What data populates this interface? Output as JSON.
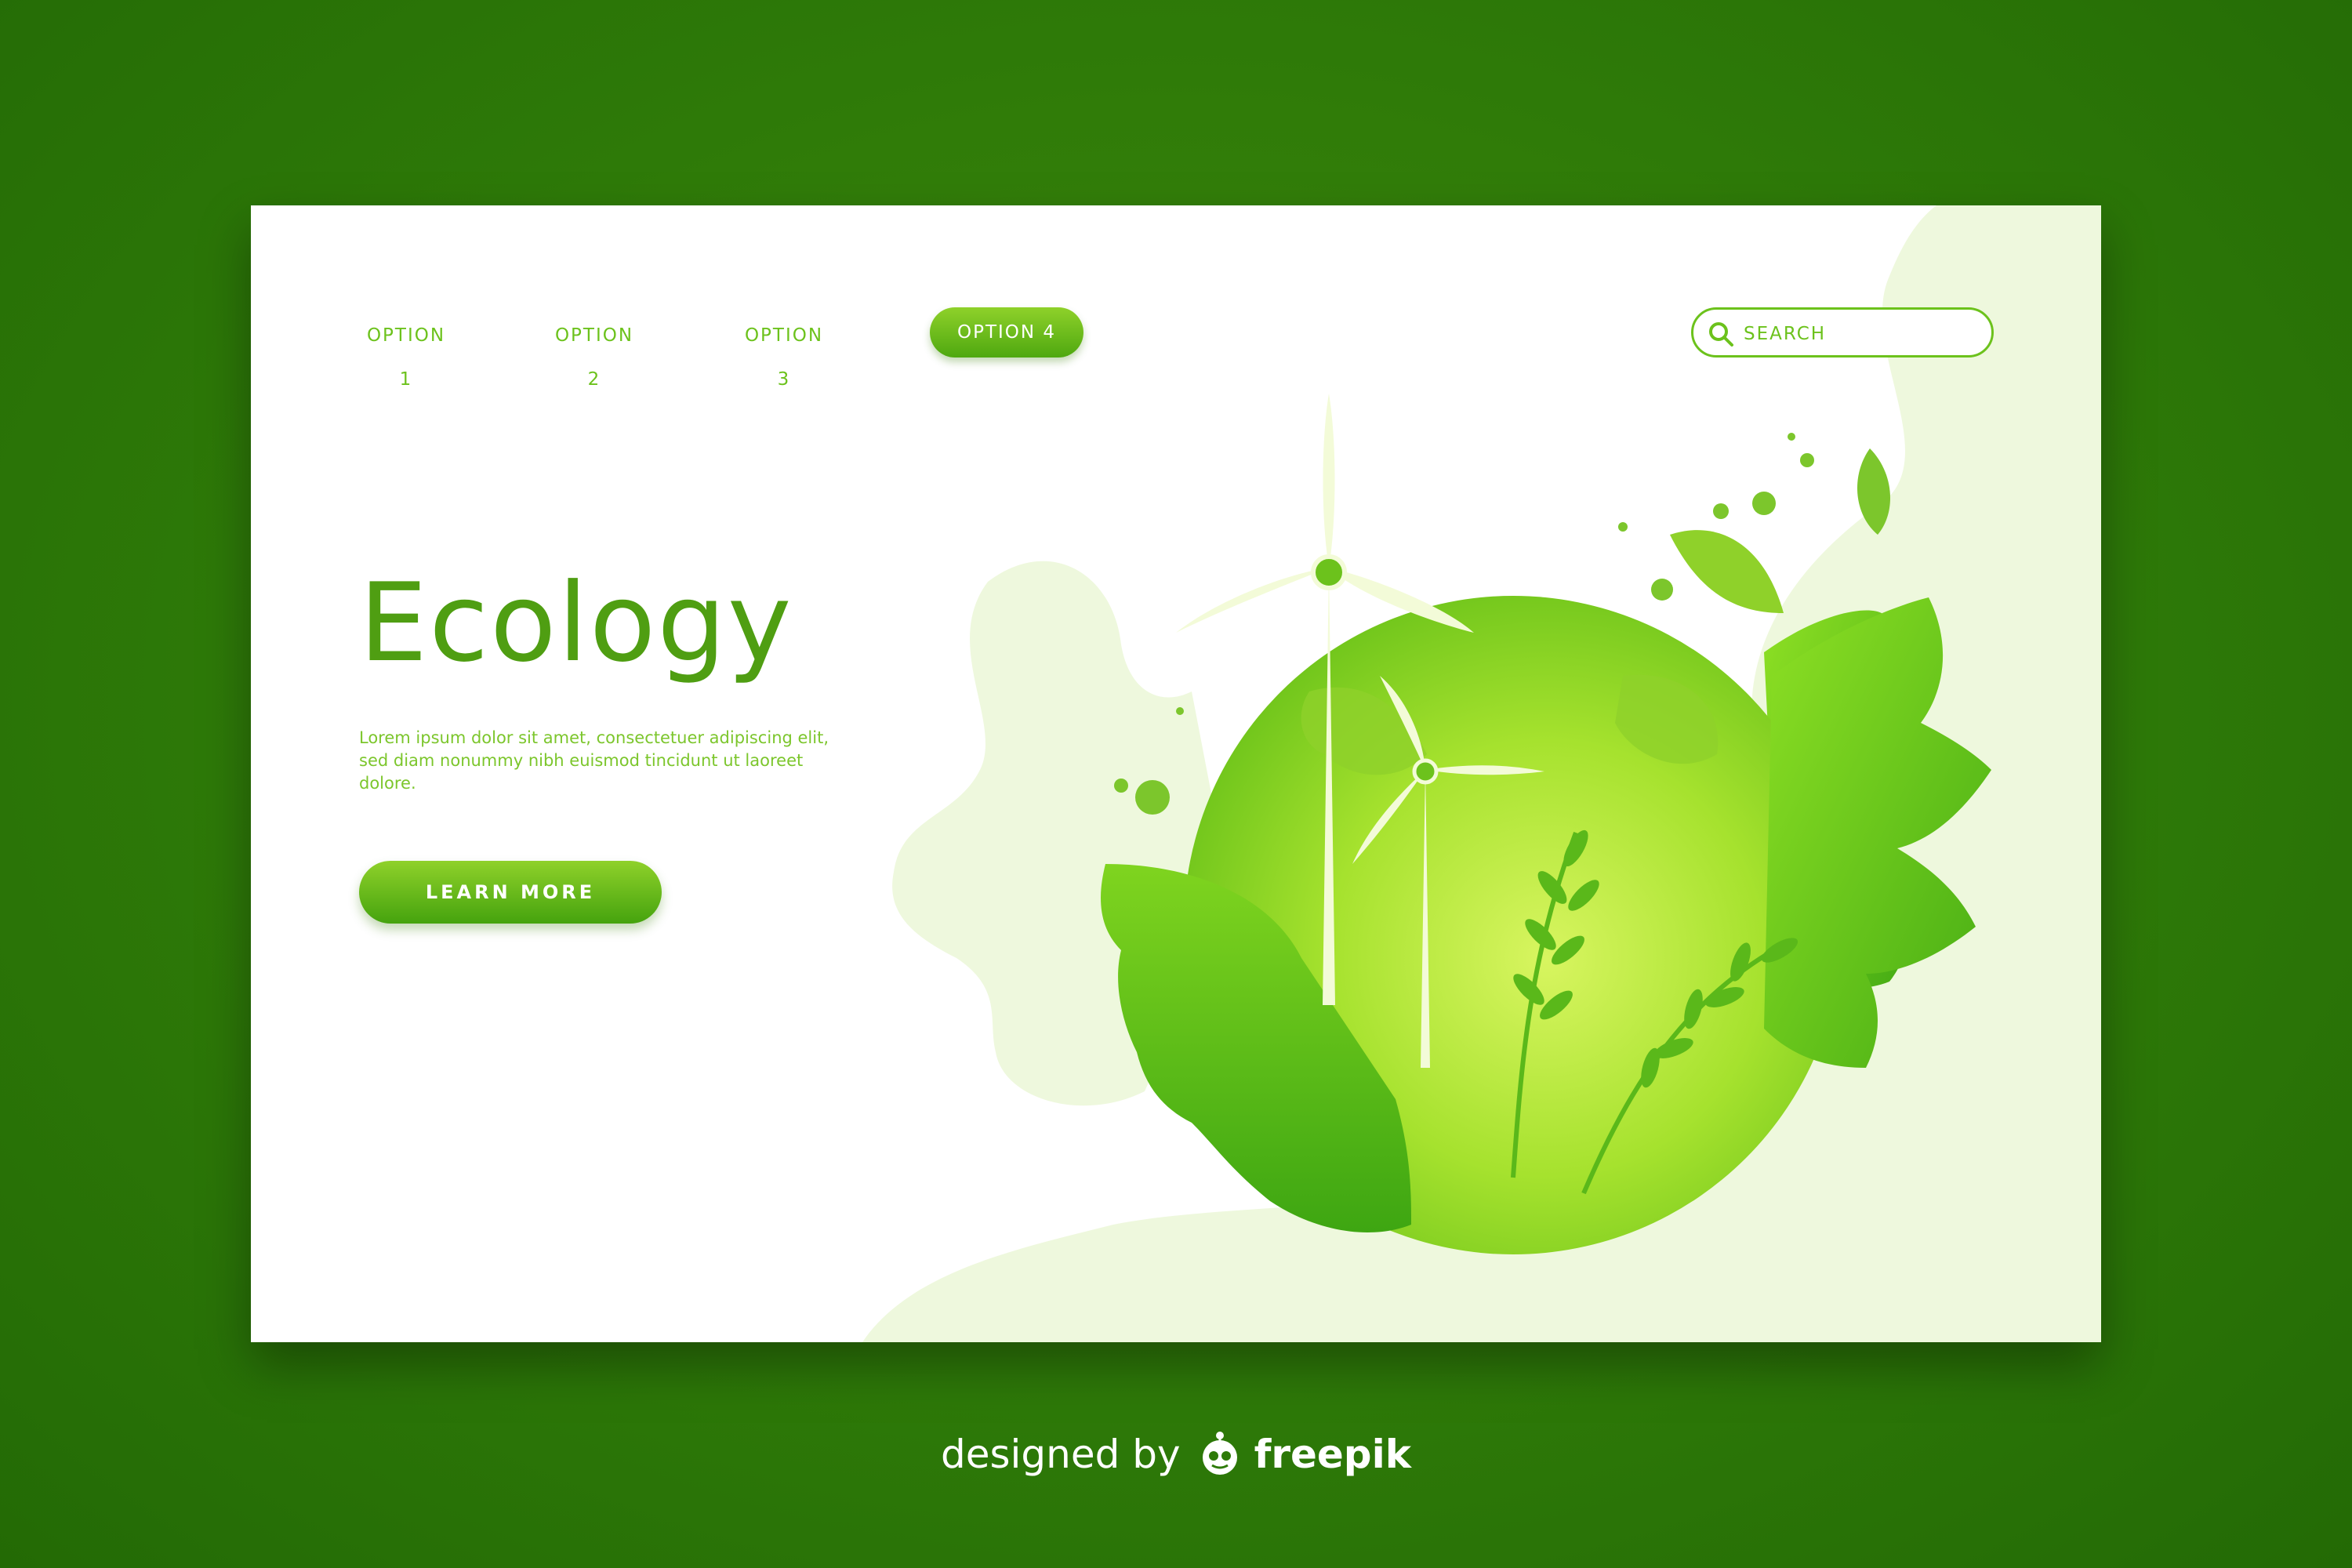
{
  "nav": {
    "items": [
      {
        "label": "OPTION 1"
      },
      {
        "label": "OPTION 2"
      },
      {
        "label": "OPTION 3"
      },
      {
        "label": "OPTION 4",
        "active": true
      }
    ]
  },
  "search": {
    "placeholder": "SEARCH",
    "icon": "search-icon"
  },
  "hero": {
    "title": "Ecology",
    "body": "Lorem ipsum dolor sit amet, consectetuer adipiscing elit, sed diam nonummy nibh euismod tincidunt ut laoreet dolore.",
    "cta_label": "LEARN MORE"
  },
  "illustration": {
    "subject": "globe with wind turbines and monstera leaves",
    "icons": [
      "globe-icon",
      "wind-turbine-icon",
      "monstera-leaf-icon",
      "fern-icon"
    ]
  },
  "credit": {
    "prefix": "designed by",
    "brand": "freepik",
    "icon": "freepik-logo-icon"
  },
  "colors": {
    "page_bg": "#2e7a08",
    "card_bg": "#ffffff",
    "accent": "#6cc21c",
    "title": "#4f9e12",
    "blob": "#eef8dd",
    "globe": "#9fe02c",
    "leaf": "#4fb916"
  }
}
